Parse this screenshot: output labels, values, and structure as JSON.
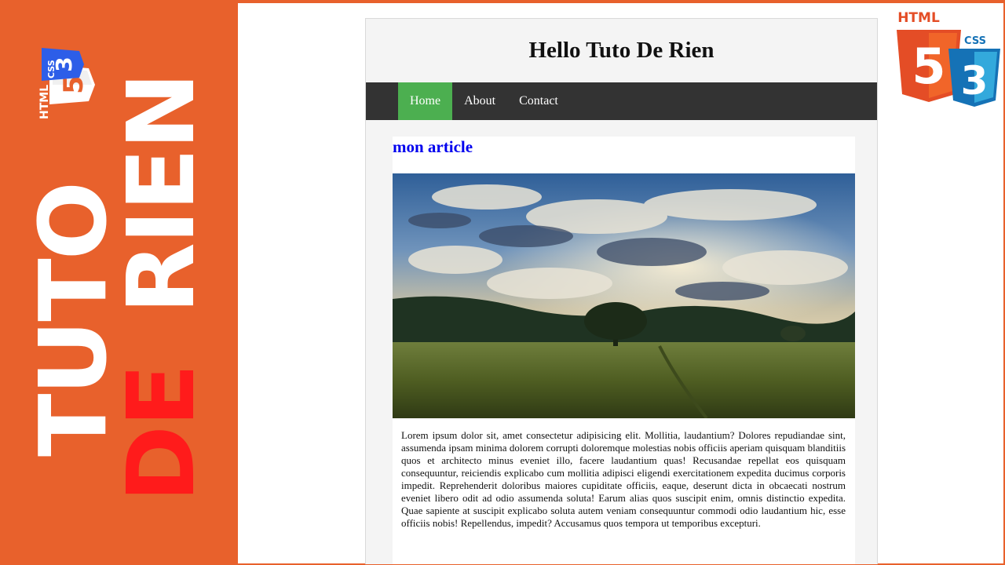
{
  "brand": {
    "line1": "TUTO",
    "line2_a": "DE",
    "line2_b": "RIEN",
    "small_logo_html": "HTML",
    "small_logo_css": "CSS",
    "colors": {
      "background": "#e8612c",
      "accent_red": "#ff1b1b",
      "text": "#ffffff"
    }
  },
  "page": {
    "title": "Hello Tuto De Rien",
    "nav": [
      {
        "label": "Home",
        "active": true
      },
      {
        "label": "About",
        "active": false
      },
      {
        "label": "Contact",
        "active": false
      }
    ],
    "article": {
      "title": "mon article",
      "image": "landscape-photo-tree-field-sky",
      "body": "Lorem ipsum dolor sit, amet consectetur adipisicing elit. Mollitia, laudantium? Dolores repudiandae sint, assumenda ipsam minima dolorem corrupti doloremque molestias nobis officiis aperiam quisquam blanditiis quos et architecto minus eveniet illo, facere laudantium quas! Recusandae repellat eos quisquam consequuntur, reiciendis explicabo cum mollitia adipisci eligendi exercitationem expedita ducimus corporis impedit. Reprehenderit doloribus maiores cupiditate officiis, eaque, deserunt dicta in obcaecati nostrum eveniet libero odit ad odio assumenda soluta! Earum alias quos suscipit enim, omnis distinctio expedita. Quae sapiente at suscipit explicabo soluta autem veniam consequuntur commodi odio laudantium hic, esse officiis nobis! Repellendus, impedit? Accusamus quos tempora ut temporibus excepturi."
    },
    "colors": {
      "nav_bg": "#333333",
      "nav_active": "#4caf50",
      "link": "#0000ee"
    }
  },
  "logos": {
    "html_label": "HTML",
    "html_number": "5",
    "css_label": "CSS",
    "css_number": "3",
    "html_color": "#e44d26",
    "css_color": "#1572b6"
  }
}
